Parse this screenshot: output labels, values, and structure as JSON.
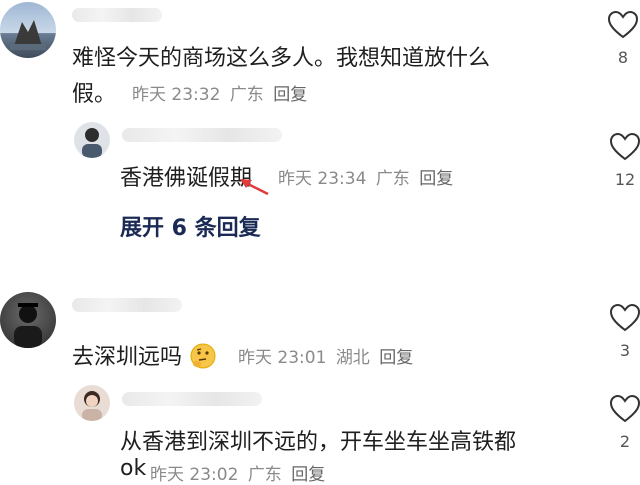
{
  "comments": [
    {
      "text_line1": "难怪今天的商场这么多人。我想知道放什么",
      "text_line2": "假。",
      "time": "昨天 23:32",
      "location": "广东",
      "reply_label": "回复",
      "likes": "8"
    },
    {
      "text": "香港佛诞假期",
      "time": "昨天 23:34",
      "location": "广东",
      "reply_label": "回复",
      "likes": "12",
      "expand_label": "展开 6 条回复"
    },
    {
      "text": "去深圳远吗",
      "emoji_icon": "thinking-face-icon",
      "time": "昨天 23:01",
      "location": "湖北",
      "reply_label": "回复",
      "likes": "3"
    },
    {
      "text_line1": "从香港到深圳不远的，开车坐车坐高铁都",
      "text_line2": "ok",
      "time": "昨天 23:02",
      "location": "广东",
      "reply_label": "回复",
      "likes": "2"
    }
  ],
  "colors": {
    "annotation_arrow": "#e23b3b",
    "expand_text": "#1b2a55"
  }
}
